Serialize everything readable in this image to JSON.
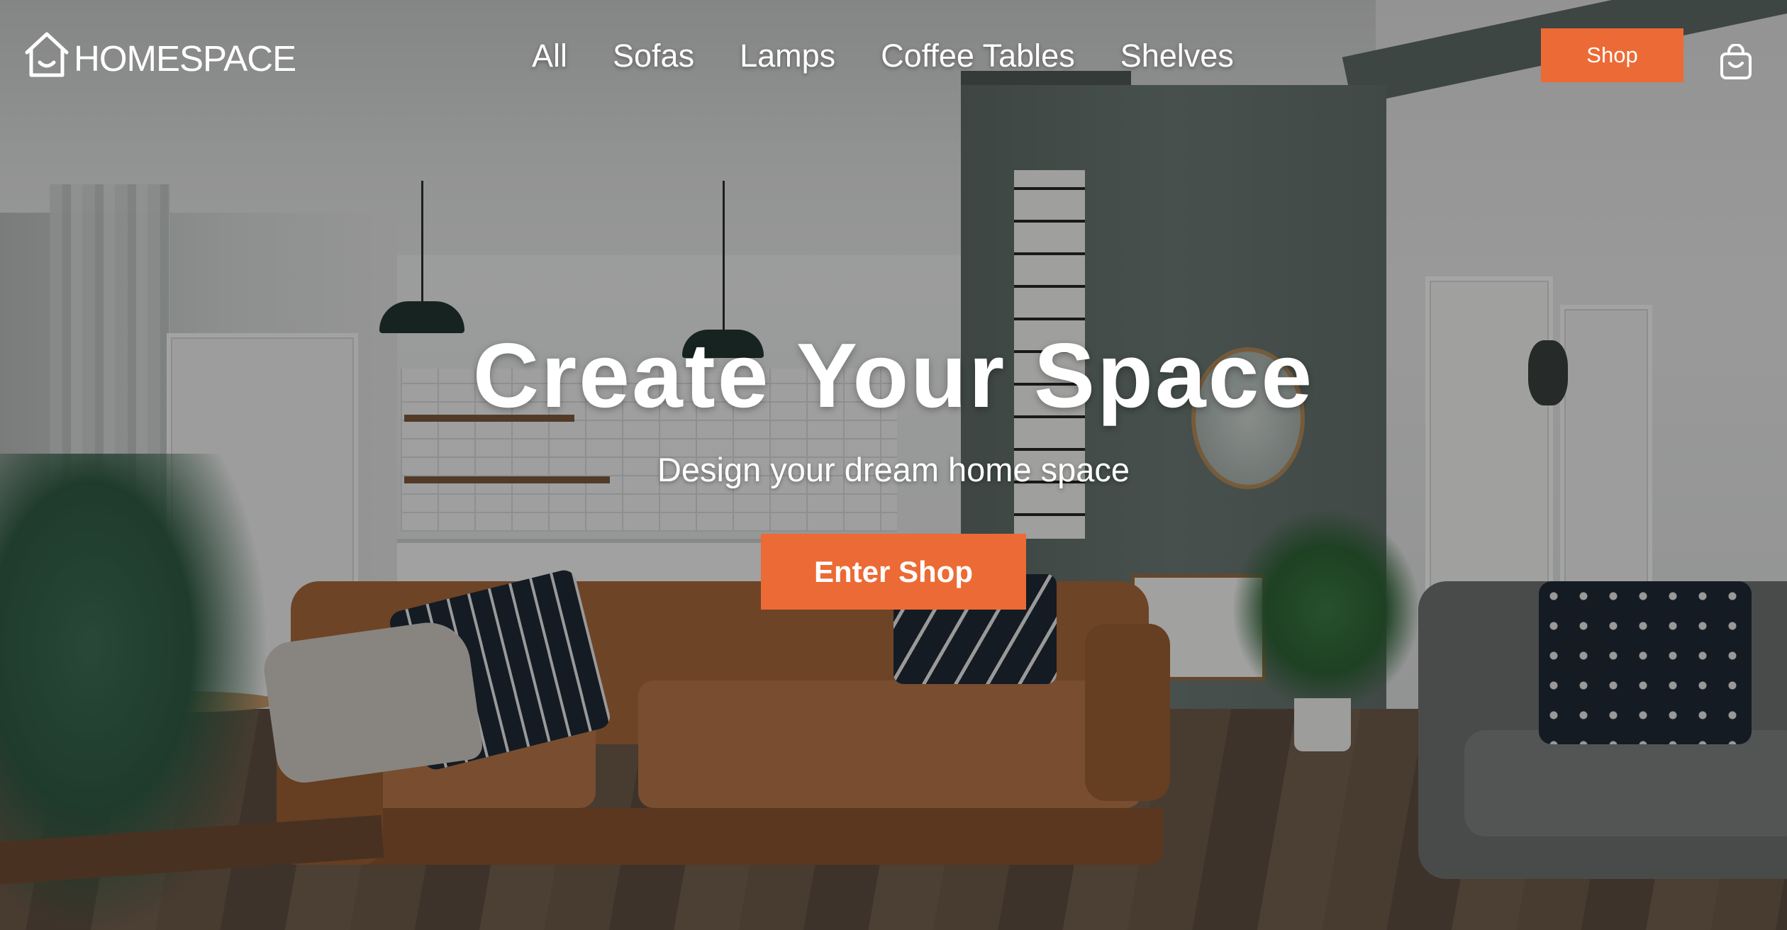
{
  "brand": {
    "logo_text": "HOMESPACE",
    "logo_icon": "house-icon"
  },
  "nav": {
    "links": [
      {
        "label": "All"
      },
      {
        "label": "Sofas"
      },
      {
        "label": "Lamps"
      },
      {
        "label": "Coffee Tables"
      },
      {
        "label": "Shelves"
      }
    ],
    "shop_button": "Shop",
    "cart_icon": "shopping-bag-icon"
  },
  "hero": {
    "headline": "Create Your Space",
    "subheadline": "Design your dream home space",
    "cta": "Enter Shop",
    "background": "living-room-photo"
  },
  "colors": {
    "accent": "#ec6a35",
    "text": "#ffffff"
  }
}
